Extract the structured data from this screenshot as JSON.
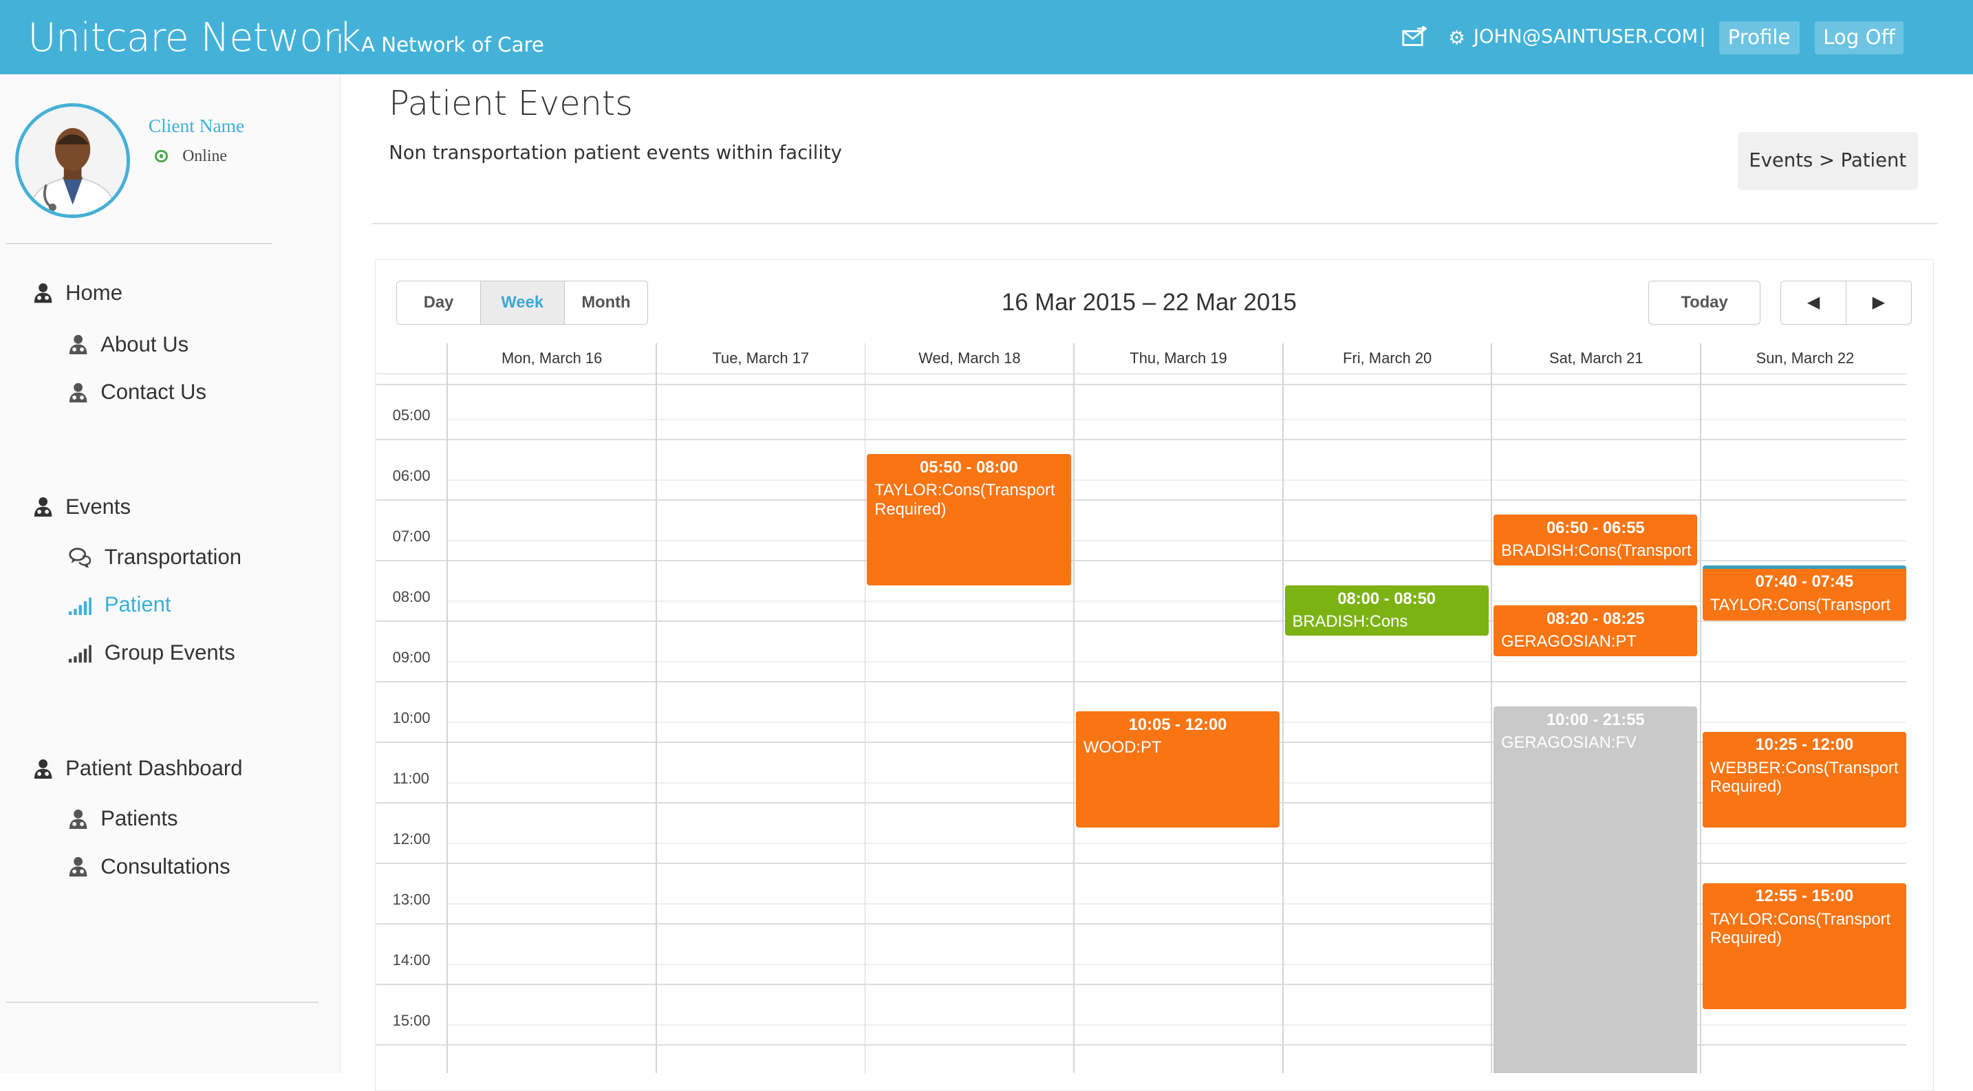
{
  "header": {
    "brand": "Unitcare Network",
    "separator": "|",
    "tagline": "A Network of Care",
    "user_email": "JOHN@SAINTUSER.COM",
    "user_separator": "|",
    "profile_label": "Profile",
    "logoff_label": "Log Off",
    "colors": {
      "bar": "#44b2d8"
    }
  },
  "sidebar": {
    "client_name": "Client Name",
    "status": "Online",
    "sections": [
      {
        "label": "Home",
        "items": [
          "About Us",
          "Contact Us"
        ]
      },
      {
        "label": "Events",
        "items": [
          "Transportation",
          "Patient",
          "Group Events"
        ],
        "active": "Patient"
      },
      {
        "label": "Patient Dashboard",
        "items": [
          "Patients",
          "Consultations"
        ]
      }
    ]
  },
  "page": {
    "title": "Patient Events",
    "subtitle": "Non transportation patient events within facility",
    "breadcrumb": "Events > Patient"
  },
  "calendar": {
    "views": [
      "Day",
      "Week",
      "Month"
    ],
    "active_view": "Week",
    "range": "16 Mar 2015 – 22 Mar 2015",
    "today_label": "Today",
    "prev_label": "◀",
    "next_label": "▶",
    "days": [
      "Mon, March 16",
      "Tue, March 17",
      "Wed, March 18",
      "Thu, March 19",
      "Fri, March 20",
      "Sat, March 21",
      "Sun, March 22"
    ],
    "hours": [
      "05:00",
      "06:00",
      "07:00",
      "08:00",
      "09:00",
      "10:00",
      "11:00",
      "12:00",
      "13:00",
      "14:00",
      "15:00"
    ],
    "colors": {
      "orange": "#f97412",
      "green": "#7cb313",
      "grey": "#c9c9c9",
      "teal": "#3a9fb5"
    },
    "events": [
      {
        "day": 2,
        "start": "05:50",
        "end": "08:00",
        "time_label": "05:50 - 08:00",
        "title": "TAYLOR:Cons(Transport Required)",
        "color": "orange"
      },
      {
        "day": 3,
        "start": "10:05",
        "end": "12:00",
        "time_label": "10:05 - 12:00",
        "title": "WOOD:PT",
        "color": "orange"
      },
      {
        "day": 4,
        "start": "08:00",
        "end": "08:50",
        "time_label": "08:00 - 08:50",
        "title": "BRADISH:Cons",
        "color": "green"
      },
      {
        "day": 5,
        "start": "06:50",
        "end": "07:40",
        "time_label": "06:50 - 06:55",
        "title": "BRADISH:Cons(Transport",
        "color": "orange"
      },
      {
        "day": 5,
        "start": "08:20",
        "end": "09:10",
        "time_label": "08:20 - 08:25",
        "title": "GERAGOSIAN:PT",
        "color": "orange"
      },
      {
        "day": 5,
        "start": "10:00",
        "end": "21:55",
        "time_label": "10:00 - 21:55",
        "title": "GERAGOSIAN:FV",
        "color": "grey"
      },
      {
        "day": 6,
        "start": "07:40",
        "end": "08:35",
        "time_label": "07:40 - 07:45",
        "title": "TAYLOR:Cons(Transport",
        "color": "orange",
        "top_stripe": "teal"
      },
      {
        "day": 6,
        "start": "10:25",
        "end": "12:00",
        "time_label": "10:25 - 12:00",
        "title": "WEBBER:Cons(Transport Required)",
        "color": "orange"
      },
      {
        "day": 6,
        "start": "12:55",
        "end": "15:00",
        "time_label": "12:55 - 15:00",
        "title": "TAYLOR:Cons(Transport Required)",
        "color": "orange"
      }
    ]
  }
}
